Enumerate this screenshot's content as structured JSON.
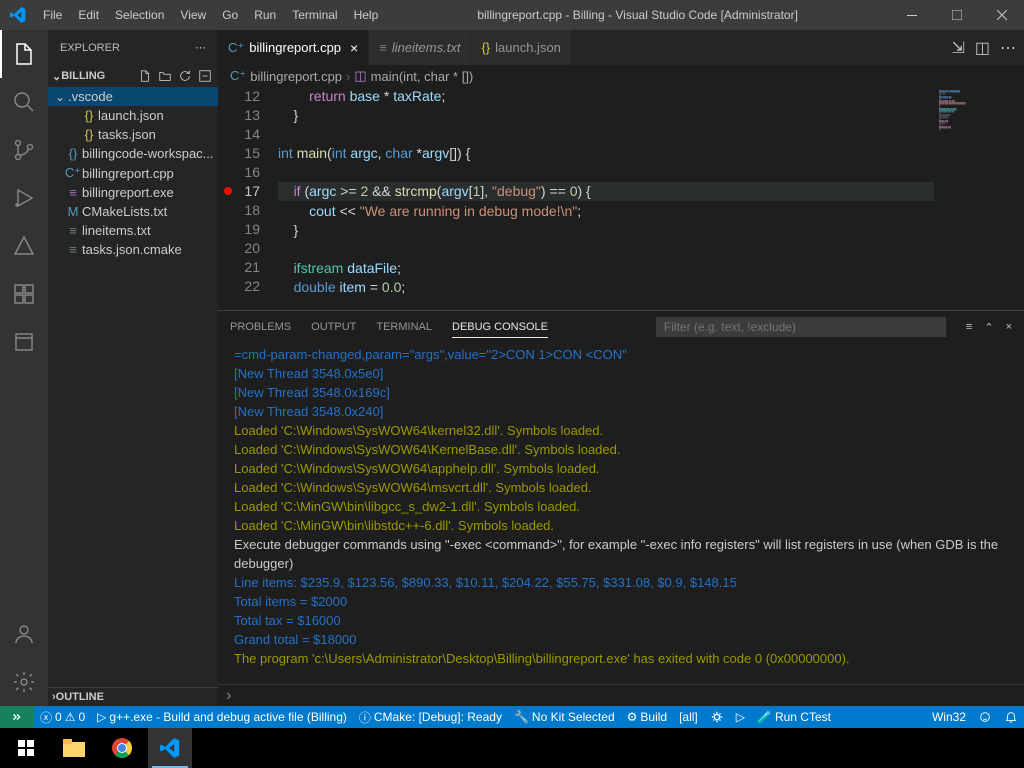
{
  "titlebar": {
    "menus": [
      "File",
      "Edit",
      "Selection",
      "View",
      "Go",
      "Run",
      "Terminal",
      "Help"
    ],
    "title": "billingreport.cpp - Billing - Visual Studio Code [Administrator]"
  },
  "sidebar": {
    "header": "EXPLORER",
    "section": "BILLING",
    "outline": "OUTLINE",
    "tree": [
      {
        "type": "folder",
        "label": ".vscode",
        "selected": true
      },
      {
        "type": "file",
        "label": "launch.json",
        "icon": "json",
        "indent": 1
      },
      {
        "type": "file",
        "label": "tasks.json",
        "icon": "json",
        "indent": 1
      },
      {
        "type": "file",
        "label": "billingcode-workspac...",
        "icon": "code",
        "indent": 0
      },
      {
        "type": "file",
        "label": "billingreport.cpp",
        "icon": "cpp",
        "indent": 0
      },
      {
        "type": "file",
        "label": "billingreport.exe",
        "icon": "exe",
        "indent": 0
      },
      {
        "type": "file",
        "label": "CMakeLists.txt",
        "icon": "cmake",
        "indent": 0
      },
      {
        "type": "file",
        "label": "lineitems.txt",
        "icon": "txt",
        "indent": 0
      },
      {
        "type": "file",
        "label": "tasks.json.cmake",
        "icon": "txt",
        "indent": 0
      }
    ]
  },
  "tabs": [
    {
      "label": "billingreport.cpp",
      "icon": "cpp",
      "active": true,
      "close": true
    },
    {
      "label": "lineitems.txt",
      "icon": "txt",
      "italic": true
    },
    {
      "label": "launch.json",
      "icon": "json"
    }
  ],
  "breadcrumb": {
    "file": "billingreport.cpp",
    "symbol": "main(int, char * [])"
  },
  "code": {
    "startLine": 12,
    "breakpointLine": 17,
    "currentLine": 17,
    "lines": [
      {
        "n": 12,
        "html": "        <span class='kw2'>return</span> <span class='var'>base</span> * <span class='var'>taxRate</span>;"
      },
      {
        "n": 13,
        "html": "    }"
      },
      {
        "n": 14,
        "html": ""
      },
      {
        "n": 15,
        "html": "<span class='kw'>int</span> <span class='fn'>main</span>(<span class='kw'>int</span> <span class='var'>argc</span>, <span class='kw'>char</span> *<span class='var'>argv</span>[]) {"
      },
      {
        "n": 16,
        "html": ""
      },
      {
        "n": 17,
        "html": "    <span class='kw2'>if</span> (<span class='var'>argc</span> &gt;= <span class='num'>2</span> &amp;&amp; <span class='fn'>strcmp</span>(<span class='var'>argv</span>[<span class='num'>1</span>], <span class='str'>\"debug\"</span>) == <span class='num'>0</span>) {"
      },
      {
        "n": 18,
        "html": "        <span class='var'>cout</span> &lt;&lt; <span class='str'>\"We are running in debug mode!\\n\"</span>;"
      },
      {
        "n": 19,
        "html": "    }"
      },
      {
        "n": 20,
        "html": ""
      },
      {
        "n": 21,
        "html": "    <span class='type'>ifstream</span> <span class='var'>dataFile</span>;"
      },
      {
        "n": 22,
        "html": "    <span class='kw'>double</span> <span class='var'>item</span> = <span class='num'>0.0</span>;"
      }
    ]
  },
  "panel": {
    "tabs": [
      "PROBLEMS",
      "OUTPUT",
      "TERMINAL",
      "DEBUG CONSOLE"
    ],
    "activeTab": 3,
    "filterPlaceholder": "Filter (e.g. text, !exclude)",
    "lines": [
      {
        "cls": "dc-blue",
        "text": "=cmd-param-changed,param=\"args\",value=\"2>CON 1>CON <CON\""
      },
      {
        "cls": "dc-blue",
        "text": "[New Thread 3548.0x5e0]"
      },
      {
        "cls": "dc-blue",
        "text": "[New Thread 3548.0x169c]"
      },
      {
        "cls": "dc-blue",
        "text": "[New Thread 3548.0x240]"
      },
      {
        "cls": "dc-yellow",
        "text": "Loaded 'C:\\Windows\\SysWOW64\\kernel32.dll'. Symbols loaded."
      },
      {
        "cls": "dc-yellow",
        "text": "Loaded 'C:\\Windows\\SysWOW64\\KernelBase.dll'. Symbols loaded."
      },
      {
        "cls": "dc-yellow",
        "text": "Loaded 'C:\\Windows\\SysWOW64\\apphelp.dll'. Symbols loaded."
      },
      {
        "cls": "dc-yellow",
        "text": "Loaded 'C:\\Windows\\SysWOW64\\msvcrt.dll'. Symbols loaded."
      },
      {
        "cls": "dc-yellow",
        "text": "Loaded 'C:\\MinGW\\bin\\libgcc_s_dw2-1.dll'. Symbols loaded."
      },
      {
        "cls": "dc-yellow",
        "text": "Loaded 'C:\\MinGW\\bin\\libstdc++-6.dll'. Symbols loaded."
      },
      {
        "cls": "dc-text",
        "text": "Execute debugger commands using \"-exec <command>\", for example \"-exec info registers\" will list registers in use (when GDB is the debugger)"
      },
      {
        "cls": "dc-blue",
        "text": "Line items: $235.9, $123.56, $890.33, $10.11, $204.22, $55.75, $331.08, $0.9, $148.15"
      },
      {
        "cls": "dc-blue",
        "text": "Total items = $2000"
      },
      {
        "cls": "dc-blue",
        "text": "Total tax = $16000"
      },
      {
        "cls": "dc-blue",
        "text": "Grand total = $18000"
      },
      {
        "cls": "dc-yellow",
        "text": "The program 'c:\\Users\\Administrator\\Desktop\\Billing\\billingreport.exe' has exited with code 0 (0x00000000)."
      }
    ]
  },
  "status": {
    "errors": "0",
    "warnings": "0",
    "launch": "g++.exe - Build and debug active file (Billing)",
    "cmake": "CMake: [Debug]: Ready",
    "kit": "No Kit Selected",
    "build": "Build",
    "target": "[all]",
    "ctest": "Run CTest",
    "platform": "Win32"
  }
}
